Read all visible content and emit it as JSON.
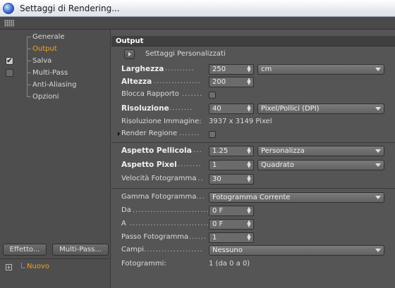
{
  "window": {
    "title": "Settaggi di Rendering...",
    "icon": "cinema4d-sphere-icon"
  },
  "sidebar": {
    "items": [
      {
        "label": "Generale",
        "checked": null,
        "selected": false
      },
      {
        "label": "Output",
        "checked": null,
        "selected": true
      },
      {
        "label": "Salva",
        "checked": true,
        "selected": false
      },
      {
        "label": "Multi-Pass",
        "checked": false,
        "selected": false
      },
      {
        "label": "Anti-Aliasing",
        "checked": null,
        "selected": false
      },
      {
        "label": "Opzioni",
        "checked": null,
        "selected": false
      }
    ],
    "effetto_button": "Effetto...",
    "multipass_button": "Multi-Pass...",
    "nuovo_label": "Nuovo",
    "checkmark": "✔"
  },
  "output": {
    "header": "Output",
    "preset_label": "Settaggi  Personalizzati",
    "larghezza": {
      "label": "Larghezza",
      "dots": "..........",
      "value": "250",
      "unit": "cm"
    },
    "altezza": {
      "label": "Altezza",
      "dots": "................",
      "value": "200"
    },
    "blocca_rapporto": {
      "label": "Blocca Rapporto",
      "dots": ".......",
      "checked": false
    },
    "risoluzione": {
      "label": "Risoluzione",
      "dots": "........",
      "value": "40",
      "unit": "Pixel/Pollici (DPI)"
    },
    "risoluzione_immagine": {
      "label": "Risoluzione Immagine:",
      "value": "3937 x 3149 Pixel"
    },
    "render_regione": {
      "label": "Render Regione",
      "dots": ".......",
      "checked": false
    },
    "aspetto_pellicola": {
      "label": "Aspetto Pellicola",
      "dots": "....",
      "value": "1.25",
      "option": "Personalizza"
    },
    "aspetto_pixel": {
      "label": "Aspetto Pixel",
      "dots": "........",
      "value": "1",
      "option": "Quadrato"
    },
    "velocita_fotogramma": {
      "label": "Velocità Fotogramma",
      "dots": "...",
      "value": "30"
    },
    "gamma_fotogramma": {
      "label": "Gamma Fotogramma",
      "dots": "...",
      "option": "Fotogramma Corrente"
    },
    "da": {
      "label": "Da",
      "dots": "...........................",
      "value": "0 F"
    },
    "a": {
      "label": "A",
      "dots": "...........................",
      "value": "0 F"
    },
    "passo_fotogramma": {
      "label": "Passo Fotogramma",
      "dots": "......",
      "value": "1"
    },
    "campi": {
      "label": "Campi",
      "dots": "....................",
      "option": "Nessuno"
    },
    "fotogrammi": {
      "label": "Fotogrammi:",
      "value": "1 (da 0 a 0)"
    }
  }
}
